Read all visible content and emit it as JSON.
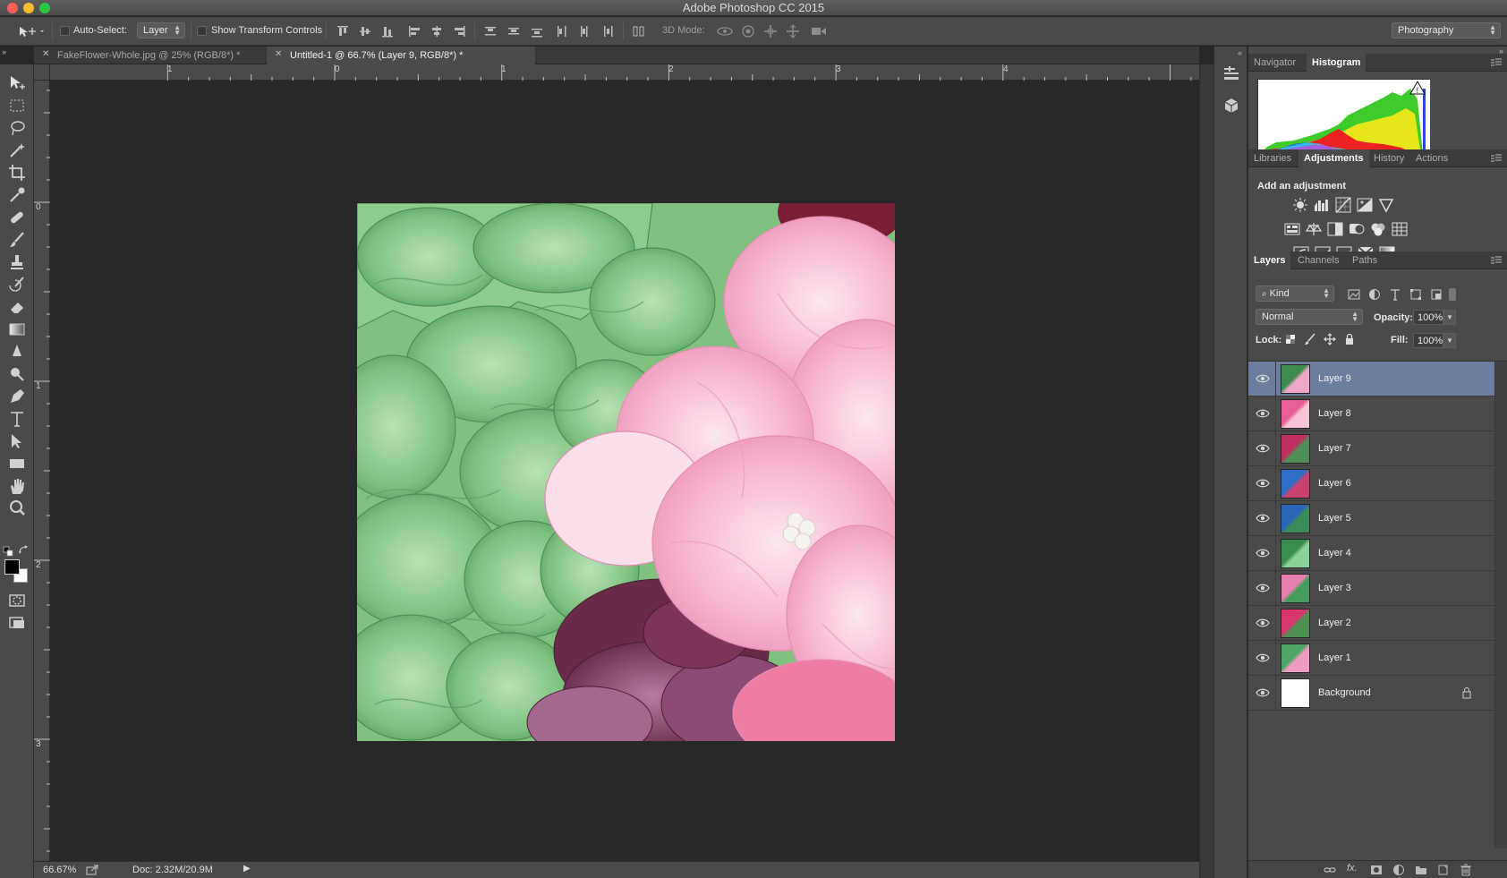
{
  "window": {
    "title": "Adobe Photoshop CC 2015"
  },
  "options_bar": {
    "auto_select_label": "Auto-Select:",
    "auto_select_value": "Layer",
    "show_transform_label": "Show Transform Controls",
    "mode_3d_label": "3D Mode:",
    "workspace": "Photography"
  },
  "doc_tabs": [
    {
      "label": "FakeFlower-Whole.jpg @ 25% (RGB/8*) *",
      "active": false
    },
    {
      "label": "Untitled-1 @ 66.7% (Layer 9, RGB/8*) *",
      "active": true
    }
  ],
  "rulers": {
    "h_labels": [
      "1",
      "0",
      "1",
      "2",
      "3",
      "4"
    ],
    "v_labels": [
      "0",
      "1",
      "2",
      "3"
    ]
  },
  "status": {
    "zoom": "66.67%",
    "doc": "Doc: 2.32M/20.9M"
  },
  "panels": {
    "group1_tabs": [
      "Navigator",
      "Histogram"
    ],
    "group1_active": "Histogram",
    "group2_tabs": [
      "Libraries",
      "Adjustments",
      "History",
      "Actions"
    ],
    "group2_active": "Adjustments",
    "adjustments_heading": "Add an adjustment",
    "group3_tabs": [
      "Layers",
      "Channels",
      "Paths"
    ],
    "group3_active": "Layers",
    "kind_filter": "Kind",
    "blend_mode": "Normal",
    "opacity_label": "Opacity:",
    "opacity_value": "100%",
    "lock_label": "Lock:",
    "fill_label": "Fill:",
    "fill_value": "100%"
  },
  "layers": [
    {
      "name": "Layer 9",
      "selected": true,
      "thumb": [
        "#3d8a4e",
        "#f0a6c8"
      ]
    },
    {
      "name": "Layer 8",
      "selected": false,
      "thumb": [
        "#e85f95",
        "#f7c3da"
      ]
    },
    {
      "name": "Layer 7",
      "selected": false,
      "thumb": [
        "#c0305e",
        "#4e8f55"
      ]
    },
    {
      "name": "Layer 6",
      "selected": false,
      "thumb": [
        "#2f6fc9",
        "#c8406f"
      ]
    },
    {
      "name": "Layer 5",
      "selected": false,
      "thumb": [
        "#2a65b8",
        "#3b8c58"
      ]
    },
    {
      "name": "Layer 4",
      "selected": false,
      "thumb": [
        "#3a8c4a",
        "#8ad09a"
      ]
    },
    {
      "name": "Layer 3",
      "selected": false,
      "thumb": [
        "#e77fb0",
        "#4a9a5b"
      ]
    },
    {
      "name": "Layer 2",
      "selected": false,
      "thumb": [
        "#d8356f",
        "#4f8f50"
      ]
    },
    {
      "name": "Layer 1",
      "selected": false,
      "thumb": [
        "#4ea565",
        "#f09cc2"
      ]
    },
    {
      "name": "Background",
      "selected": false,
      "thumb": [
        "#ffffff",
        "#ffffff"
      ],
      "locked": true
    }
  ]
}
